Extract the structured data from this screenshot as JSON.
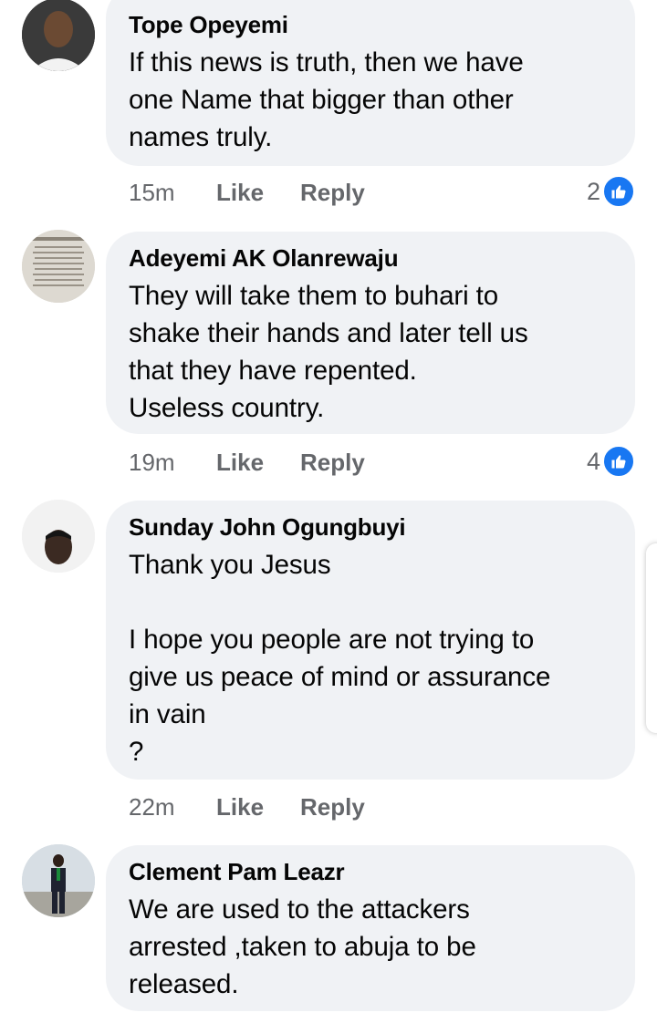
{
  "comments": [
    {
      "author": "Tope Opeyemi",
      "text": "If this news is truth, then we have\none Name that bigger than other\nnames truly.",
      "time": "15m",
      "like_label": "Like",
      "reply_label": "Reply",
      "reaction_count": "2",
      "reaction_icon": "thumbs-up-icon"
    },
    {
      "author": "Adeyemi AK Olanrewaju",
      "text": "They will take them to buhari to\nshake their hands and later tell us\nthat they have repented.\nUseless country.",
      "time": "19m",
      "like_label": "Like",
      "reply_label": "Reply",
      "reaction_count": "4",
      "reaction_icon": "thumbs-up-icon"
    },
    {
      "author": "Sunday John Ogungbuyi",
      "text": "Thank you Jesus\n\nI hope you people are not trying to\ngive us peace of mind or assurance\nin vain\n?",
      "time": "22m",
      "like_label": "Like",
      "reply_label": "Reply"
    },
    {
      "author": "Clement Pam Leazr",
      "text": "We are used to the attackers\narrested ,taken to abuja to be\nreleased."
    }
  ],
  "colors": {
    "bubble": "#f0f2f5",
    "meta_text": "#65676b",
    "like_blue": "#1877f2"
  }
}
